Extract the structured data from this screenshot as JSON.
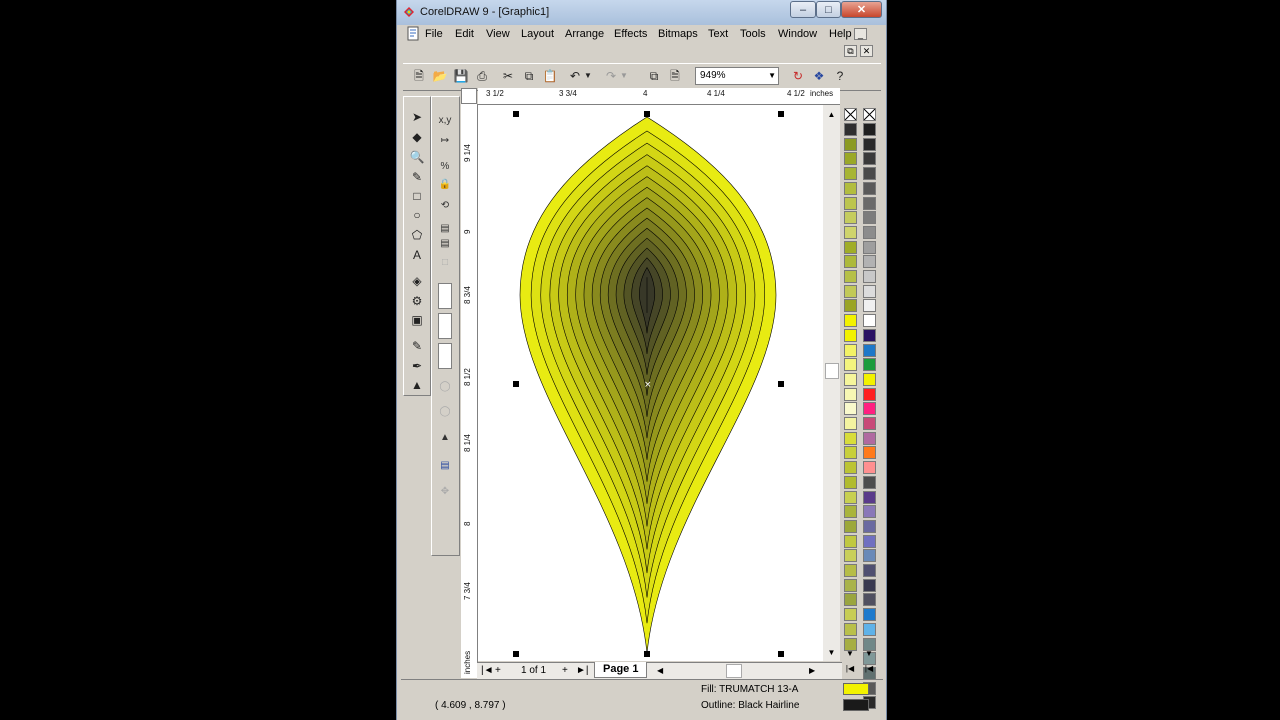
{
  "window": {
    "title": "CorelDRAW 9 - [Graphic1]",
    "minimize": "–",
    "maximize": "□",
    "close": "✕"
  },
  "menu": {
    "items": [
      "File",
      "Edit",
      "View",
      "Layout",
      "Arrange",
      "Effects",
      "Bitmaps",
      "Text",
      "Tools",
      "Window",
      "Help"
    ],
    "mdi_minimize": "_",
    "mdi_restore": "⧉",
    "mdi_close": "✕"
  },
  "toolbar": {
    "zoom_value": "949%",
    "icons": [
      "new-icon",
      "open-icon",
      "save-icon",
      "print-icon",
      "cut-icon",
      "copy-icon",
      "paste-icon",
      "undo-icon",
      "undo-dropdown-icon",
      "redo-icon",
      "redo-dropdown-icon",
      "import-icon",
      "export-icon",
      "corel-online-icon",
      "whats-this-icon",
      "help-icon"
    ]
  },
  "rulers": {
    "horizontal_labels": [
      "3 1/2",
      "3 3/4",
      "4",
      "4 1/4",
      "4 1/2",
      "inches"
    ],
    "vertical_labels": [
      "9 1/4",
      "9",
      "8 3/4",
      "8 1/2",
      "8 1/4",
      "8",
      "7 3/4",
      "inches"
    ]
  },
  "drawing": {
    "fill_color": "#e8eb12",
    "center_color": "#2a2a2a",
    "outline_color": "#000000",
    "contour_steps": 15
  },
  "navigation": {
    "first": "|◄",
    "add_before": "+",
    "page_count": "1 of 1",
    "add_after": "+",
    "last": "►|",
    "page_tab": "Page 1"
  },
  "status": {
    "coords": "( 4.609 , 8.797 )",
    "fill_text": "Fill: TRUMATCH 13-A",
    "outline_text": "Outline: Black  Hairline",
    "fill_swatch_color": "#f2f200",
    "outline_swatch_color": "#1a1a1a"
  },
  "palette": {
    "col1": [
      "#2f2f2f",
      "#8b9a22",
      "#9aa828",
      "#a7b534",
      "#b2bd3e",
      "#bcc54e",
      "#c5cc5e",
      "#cfd46c",
      "#a0ad28",
      "#adb93a",
      "#b6c047",
      "#c2c957",
      "#9aa424",
      "#f2f200",
      "#f2f200",
      "#f2f266",
      "#f4f47e",
      "#f5f59b",
      "#f7f7b3",
      "#f9f9cc",
      "#f4f4a0",
      "#d8dc3a",
      "#c8cf3a",
      "#bcc434",
      "#b1bb2e",
      "#c8d050",
      "#a9b43c",
      "#9ca83a",
      "#c0c840",
      "#c9cf5a",
      "#b6bd48",
      "#a9b34a",
      "#9aa540",
      "#c7cd55",
      "#b9c04a",
      "#a6ae42"
    ],
    "col2": [
      "#1f1f1f",
      "#2a2a2a",
      "#3a3a3a",
      "#4a4a4a",
      "#5a5a5a",
      "#6a6a6a",
      "#7c7c7c",
      "#8c8c8c",
      "#9e9e9e",
      "#b2b2b2",
      "#c8c8c8",
      "#dcdcdc",
      "#f0f0f0",
      "#ffffff",
      "#2b1263",
      "#1f78c8",
      "#1c9c3c",
      "#f2f200",
      "#ff2020",
      "#ff2080",
      "#c84a78",
      "#b06aa0",
      "#ff7a1a",
      "#ff9090",
      "#4d4d4d",
      "#5a3a8a",
      "#8a78b8",
      "#6a6aa0",
      "#7070c0",
      "#6a8ab8",
      "#505070",
      "#3a3a50",
      "#505060",
      "#1e7acc",
      "#5fb2e8",
      "#708888",
      "#809898",
      "#607070",
      "#5a5a5a",
      "#2a2a2a"
    ]
  }
}
